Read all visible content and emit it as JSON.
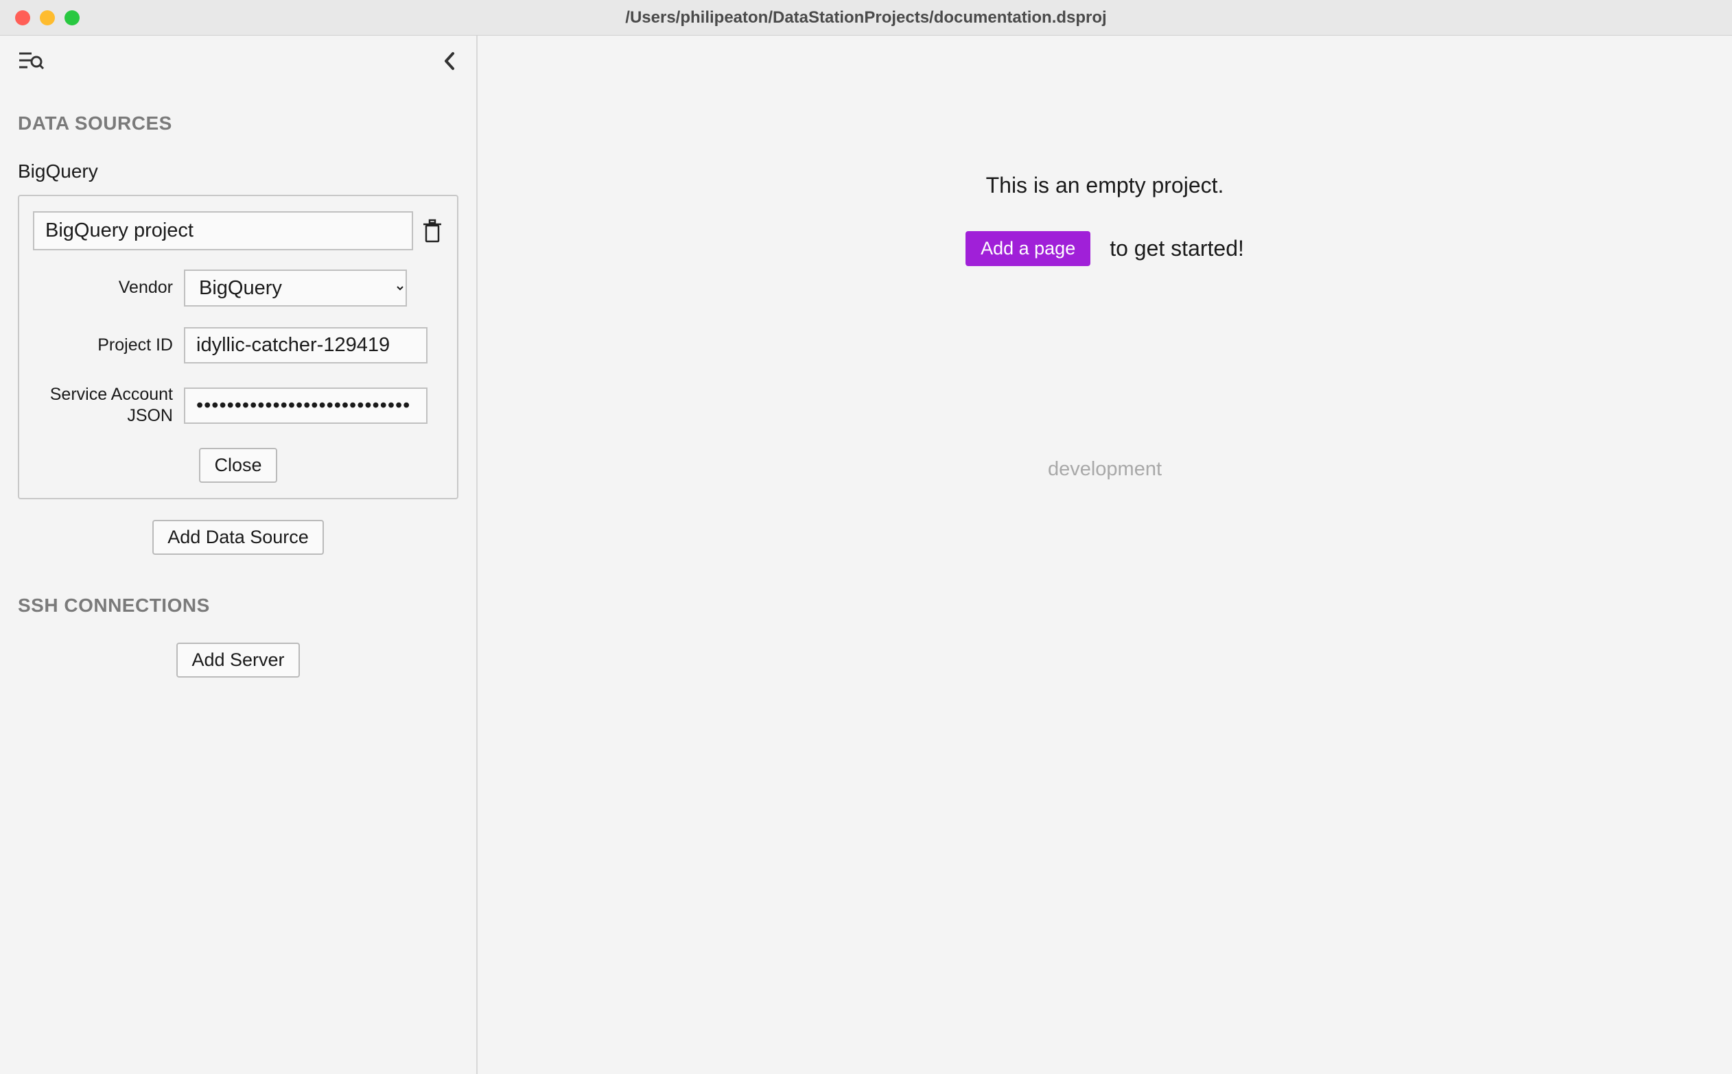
{
  "window": {
    "title": "/Users/philipeaton/DataStationProjects/documentation.dsproj"
  },
  "sidebar": {
    "sections": {
      "data_sources": {
        "heading": "DATA SOURCES",
        "items": [
          {
            "label": "BigQuery",
            "name_value": "BigQuery project",
            "fields": {
              "vendor": {
                "label": "Vendor",
                "value": "BigQuery"
              },
              "project_id": {
                "label": "Project ID",
                "value": "idyllic-catcher-129419"
              },
              "service_account_json": {
                "label": "Service Account JSON",
                "value": "••••••••••••••••••••••••••••"
              }
            },
            "close_label": "Close"
          }
        ],
        "add_label": "Add Data Source"
      },
      "ssh": {
        "heading": "SSH CONNECTIONS",
        "add_label": "Add Server"
      }
    }
  },
  "main": {
    "empty_message": "This is an empty project.",
    "cta_button": "Add a page",
    "cta_rest": "to get started!",
    "footer_text": "development"
  },
  "colors": {
    "accent": "#a020d8"
  }
}
